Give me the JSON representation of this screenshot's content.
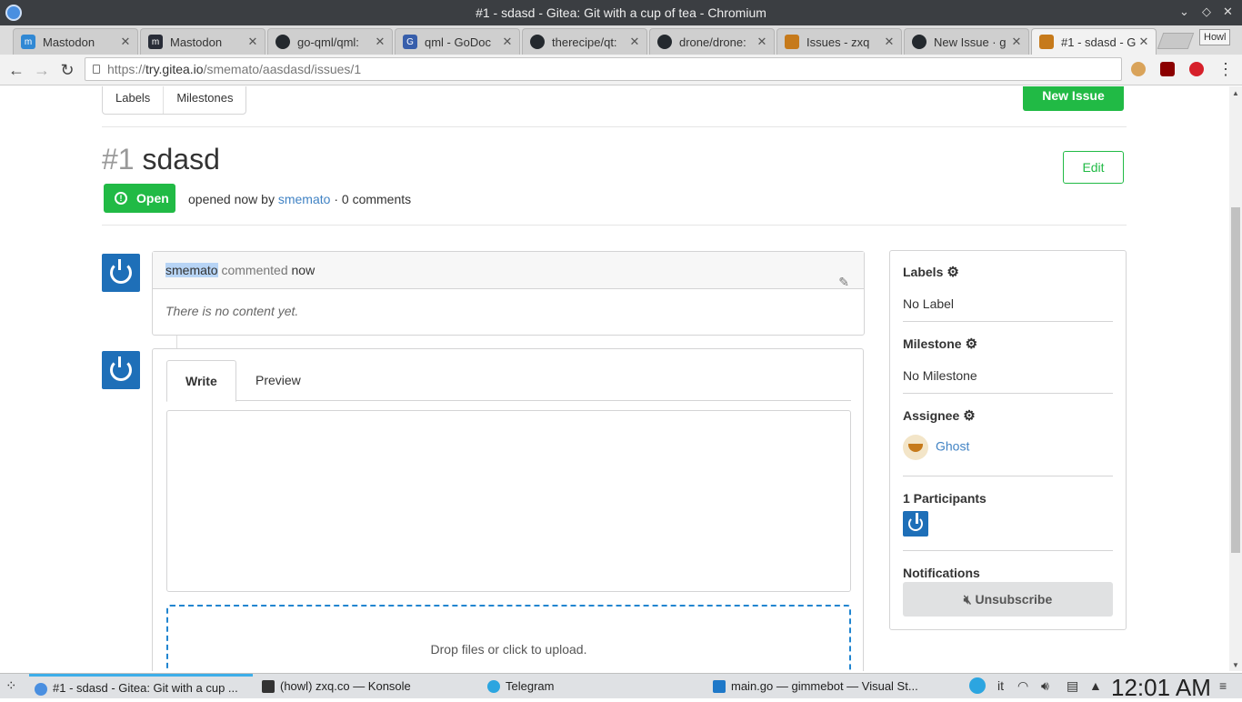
{
  "window": {
    "title": "#1 - sdasd - Gitea: Git with a cup of tea - Chromium"
  },
  "tabs": [
    {
      "label": "Mastodon",
      "icon": "mastodon-icon",
      "color": "#3088d4"
    },
    {
      "label": "Mastodon",
      "icon": "mastodon-icon",
      "color": "#282c37"
    },
    {
      "label": "go-qml/qml:",
      "icon": "github-icon",
      "color": "#24292e"
    },
    {
      "label": "qml - GoDoc",
      "icon": "godoc-icon",
      "color": "#375eab"
    },
    {
      "label": "therecipe/qt:",
      "icon": "github-icon",
      "color": "#24292e"
    },
    {
      "label": "drone/drone:",
      "icon": "github-icon",
      "color": "#24292e"
    },
    {
      "label": "Issues - zxq",
      "icon": "gitea-icon",
      "color": "#c67a1b"
    },
    {
      "label": "New Issue · g",
      "icon": "github-icon",
      "color": "#24292e"
    },
    {
      "label": "#1 - sdasd - G",
      "icon": "gitea-icon",
      "color": "#c67a1b"
    }
  ],
  "profile": "Howl",
  "address": {
    "scheme": "https://",
    "host": "try.gitea.io",
    "path": "/smemato/aasdasd/issues/1"
  },
  "nav": {
    "labels": "Labels",
    "milestones": "Milestones",
    "new_issue": "New Issue"
  },
  "issue": {
    "number": "#1",
    "title": "sdasd",
    "edit": "Edit",
    "state": "Open",
    "opened": "opened now by",
    "author": "smemato",
    "separator": "·",
    "comments": "0 comments"
  },
  "comment": {
    "author": "smemato",
    "action": "commented",
    "time": "now",
    "body": "There is no content yet."
  },
  "editor": {
    "tab_write": "Write",
    "tab_preview": "Preview",
    "dropzone": "Drop files or click to upload."
  },
  "sidebar": {
    "labels_title": "Labels",
    "labels_value": "No Label",
    "milestone_title": "Milestone",
    "milestone_value": "No Milestone",
    "assignee_title": "Assignee",
    "assignee_value": "Ghost",
    "participants_title": "1 Participants",
    "notifications_title": "Notifications",
    "unsubscribe": "Unsubscribe"
  },
  "taskbar": {
    "items": [
      {
        "label": "#1 - sdasd - Gitea: Git with a cup ...",
        "color": "#4a8fe0"
      },
      {
        "label": "(howl) zxq.co — Konsole",
        "color": "#333333"
      },
      {
        "label": "Telegram",
        "color": "#2ca5e0"
      },
      {
        "label": "main.go — gimmebot — Visual St...",
        "color": "#1e78c8"
      }
    ],
    "lang": "it",
    "clock": "12:01 AM"
  },
  "colors": {
    "green": "#21ba45",
    "link": "#4183c4",
    "avatar": "#1e6fb8"
  }
}
